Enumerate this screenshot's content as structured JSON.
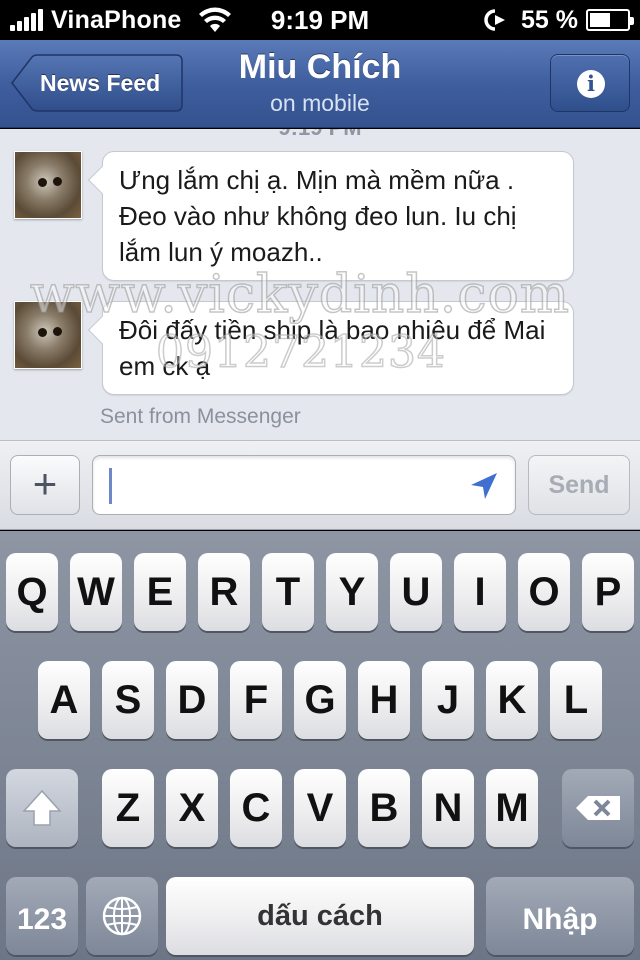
{
  "status_bar": {
    "carrier": "VinaPhone",
    "time": "9:19 PM",
    "battery": "55 %",
    "battery_level": 0.55
  },
  "nav": {
    "back_label": "News Feed",
    "title": "Miu Chích",
    "subtitle": "on mobile",
    "info_icon": "i"
  },
  "chat": {
    "timestamp_partial": "9:19 PM",
    "messages": [
      {
        "text": "Ưng lắm chị ạ. Mịn mà mềm nữa . Đeo vào như không đeo lun. Iu chị lắm lun ý moazh.."
      },
      {
        "text": "Đôi đấy tiền ship là bao nhiêu để Mai em ck ạ"
      }
    ],
    "sent_from": "Sent from Messenger",
    "watermark": {
      "site": "www.vickydinh.com",
      "phone": "0912721234"
    }
  },
  "compose": {
    "plus": "+",
    "placeholder": "",
    "send_label": "Send"
  },
  "keyboard": {
    "row1": [
      "Q",
      "W",
      "E",
      "R",
      "T",
      "Y",
      "U",
      "I",
      "O",
      "P"
    ],
    "row2": [
      "A",
      "S",
      "D",
      "F",
      "G",
      "H",
      "J",
      "K",
      "L"
    ],
    "row3": [
      "Z",
      "X",
      "C",
      "V",
      "B",
      "N",
      "M"
    ],
    "numbers_label": "123",
    "space_label": "dấu cách",
    "return_label": "Nhập"
  }
}
